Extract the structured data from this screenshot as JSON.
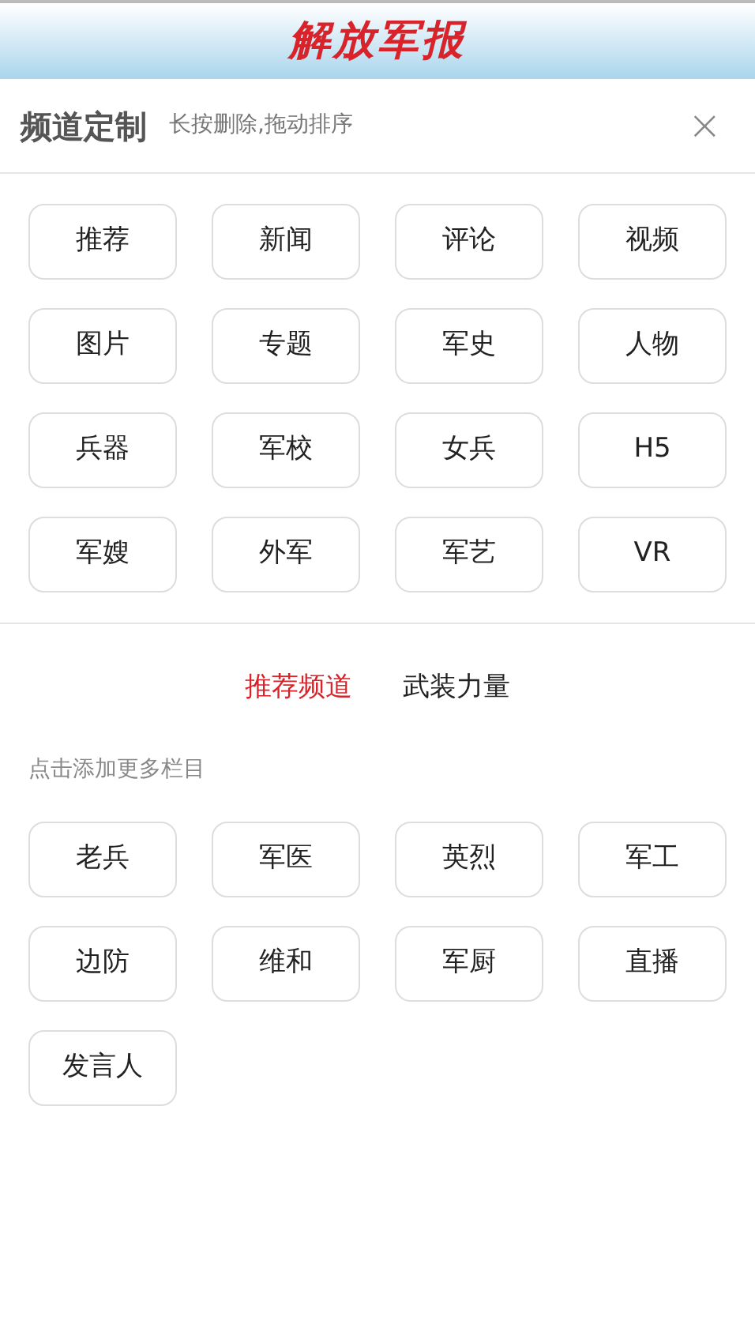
{
  "header": {
    "logo": "解放军报"
  },
  "panel": {
    "title": "频道定制",
    "hint": "长按删除,拖动排序",
    "close": "×"
  },
  "my_channels": [
    "推荐",
    "新闻",
    "评论",
    "视频",
    "图片",
    "专题",
    "军史",
    "人物",
    "兵器",
    "军校",
    "女兵",
    "H5",
    "军嫂",
    "外军",
    "军艺",
    "VR"
  ],
  "tabs": [
    {
      "label": "推荐频道",
      "selected": true
    },
    {
      "label": "武装力量",
      "selected": false
    }
  ],
  "add_hint": "点击添加更多栏目",
  "more_channels": [
    "老兵",
    "军医",
    "英烈",
    "军工",
    "边防",
    "维和",
    "军厨",
    "直播",
    "发言人"
  ]
}
